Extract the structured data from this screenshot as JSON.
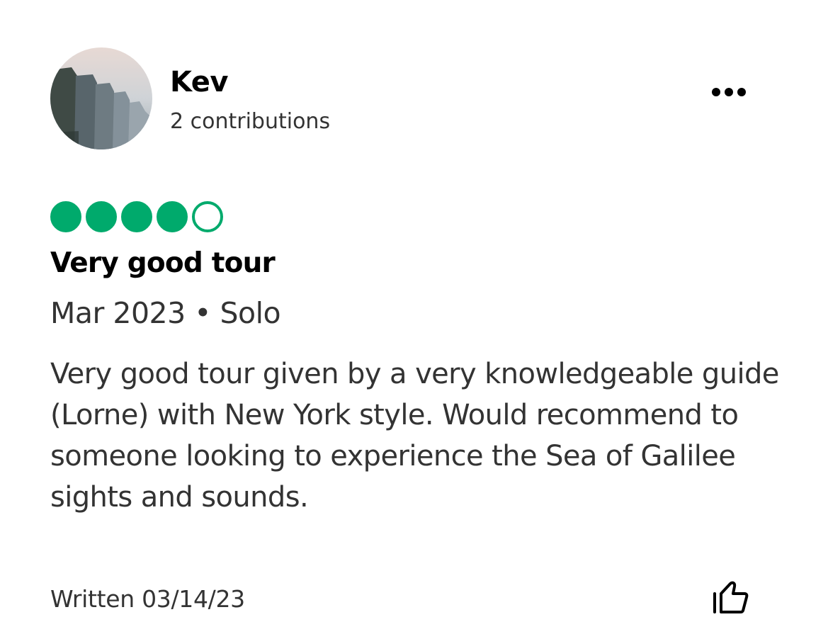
{
  "author": {
    "name": "Kev",
    "contributions": "2 contributions"
  },
  "more_button": {
    "icon": "more-horizontal-icon"
  },
  "rating": {
    "value": 4,
    "max": 5,
    "color": "#00aa6c"
  },
  "review": {
    "title": "Very good tour",
    "meta": "Mar 2023 • Solo",
    "body": "Very good tour given by a very knowledgeable guide (Lorne) with New York style. Would recommend to someone looking to experience the Sea of Galilee sights and sounds.",
    "written": "Written 03/14/23"
  },
  "helpful_button": {
    "icon": "thumbs-up-icon"
  }
}
